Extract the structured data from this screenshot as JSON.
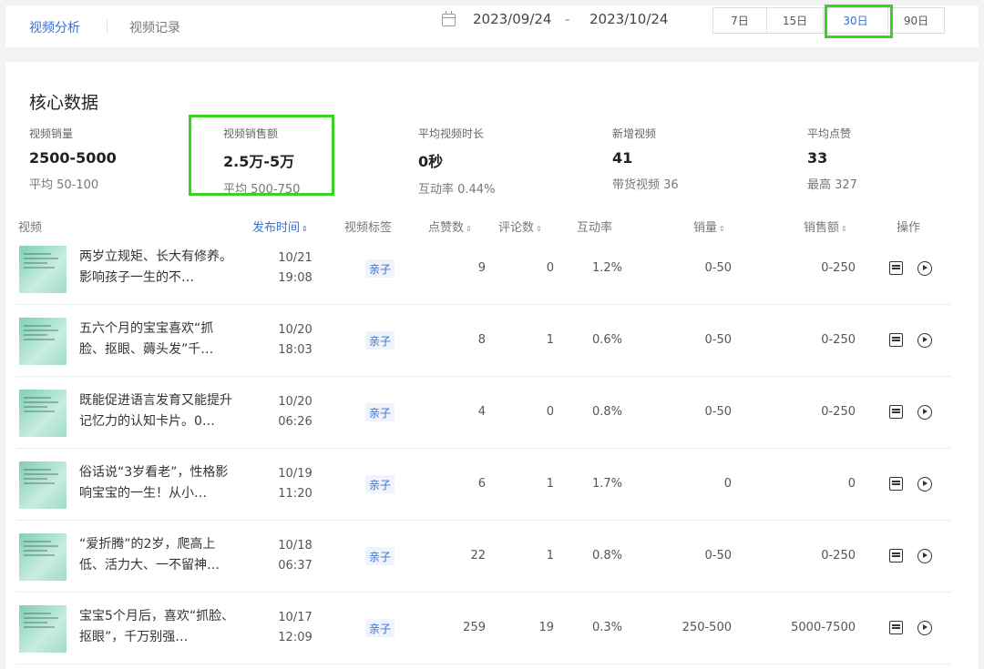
{
  "header": {
    "tabs": [
      "视频分析",
      "视频记录"
    ],
    "date_start": "2023/09/24",
    "date_sep": "-",
    "date_end": "2023/10/24",
    "ranges": [
      "7日",
      "15日",
      "30日",
      "90日"
    ],
    "active_range": "30日"
  },
  "core": {
    "title": "核心数据",
    "metrics": [
      {
        "label": "视频销量",
        "value": "2500-5000",
        "sub": "平均 50-100"
      },
      {
        "label": "视频销售额",
        "value": "2.5万-5万",
        "sub": "平均 500-750"
      },
      {
        "label": "平均视频时长",
        "value": "0秒",
        "sub": "互动率 0.44%"
      },
      {
        "label": "新增视频",
        "value": "41",
        "sub": "带货视频 36"
      },
      {
        "label": "平均点赞",
        "value": "33",
        "sub": "最高 327"
      }
    ]
  },
  "table": {
    "headers": {
      "video": "视频",
      "time": "发布时间",
      "tag": "视频标签",
      "likes": "点赞数",
      "comments": "评论数",
      "interaction": "互动率",
      "sales": "销量",
      "amount": "销售额",
      "ops": "操作"
    },
    "sort_icon": "⇕",
    "rows": [
      {
        "title": "两岁立规矩、长大有修养。影响孩子一生的不…",
        "date": "10/21",
        "time": "19:08",
        "tag": "亲子",
        "likes": "9",
        "comments": "0",
        "interaction": "1.2%",
        "sales": "0-50",
        "amount": "0-250"
      },
      {
        "title": "五六个月的宝宝喜欢“抓脸、抠眼、薅头发”千…",
        "date": "10/20",
        "time": "18:03",
        "tag": "亲子",
        "likes": "8",
        "comments": "1",
        "interaction": "0.6%",
        "sales": "0-50",
        "amount": "0-250"
      },
      {
        "title": "既能促进语言发育又能提升记忆力的认知卡片。0…",
        "date": "10/20",
        "time": "06:26",
        "tag": "亲子",
        "likes": "4",
        "comments": "0",
        "interaction": "0.8%",
        "sales": "0-50",
        "amount": "0-250"
      },
      {
        "title": "俗话说“3岁看老”，性格影响宝宝的一生！从小…",
        "date": "10/19",
        "time": "11:20",
        "tag": "亲子",
        "likes": "6",
        "comments": "1",
        "interaction": "1.7%",
        "sales": "0",
        "amount": "0"
      },
      {
        "title": "“爱折腾”的2岁，爬高上低、活力大、一不留神…",
        "date": "10/18",
        "time": "06:37",
        "tag": "亲子",
        "likes": "22",
        "comments": "1",
        "interaction": "0.8%",
        "sales": "0-50",
        "amount": "0-250"
      },
      {
        "title": "宝宝5个月后，喜欢“抓脸、抠眼”，千万别强…",
        "date": "10/17",
        "time": "12:09",
        "tag": "亲子",
        "likes": "259",
        "comments": "19",
        "interaction": "0.3%",
        "sales": "250-500",
        "amount": "5000-7500"
      }
    ]
  }
}
